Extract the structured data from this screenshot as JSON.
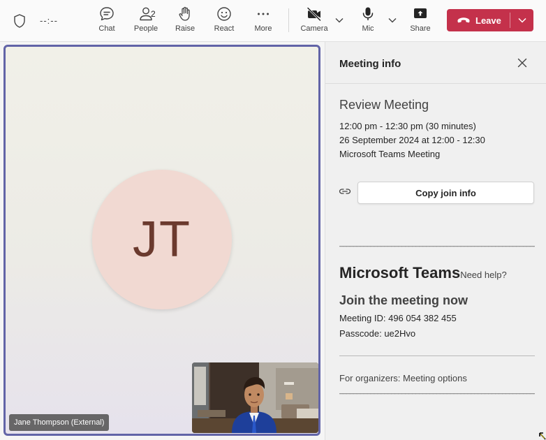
{
  "toolbar": {
    "timer": "--:--",
    "buttons": {
      "chat": "Chat",
      "people": "People",
      "people_count": "2",
      "raise": "Raise",
      "react": "React",
      "more": "More",
      "camera": "Camera",
      "mic": "Mic",
      "share": "Share"
    },
    "leave_label": "Leave",
    "leave_color": "#c4314b"
  },
  "stage": {
    "initials": "JT",
    "participant_name": "Jane Thompson (External)",
    "active_border_color": "#6264a7"
  },
  "panel": {
    "title": "Meeting info",
    "meeting_name": "Review Meeting",
    "time_range": "12:00 pm - 12:30 pm (30 minutes)",
    "date_line": "26 September 2024 at 12:00 - 12:30",
    "meeting_type": "Microsoft Teams Meeting",
    "copy_button": "Copy join info",
    "separator": "________________________________________________________________________________",
    "brand": "Microsoft Teams",
    "help_link": "Need help?",
    "join_heading": "Join the meeting now",
    "meeting_id": "Meeting ID: 496 054 382 455",
    "passcode": "Passcode: ue2Hvo",
    "organizers_prefix": "For organizers: ",
    "organizers_link": "Meeting options"
  }
}
